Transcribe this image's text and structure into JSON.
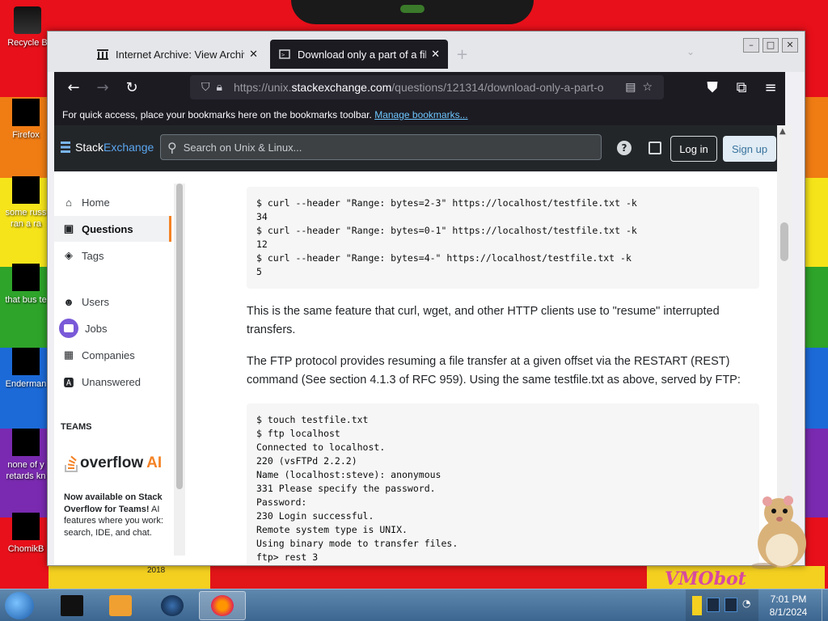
{
  "desktop": {
    "icons": [
      {
        "label": "Recycle B",
        "name": "recycle-bin"
      },
      {
        "label": "Firefox",
        "name": "firefox"
      },
      {
        "label": "some russ",
        "label2": "ran a ra",
        "name": "some-russ"
      },
      {
        "label": "that bus te",
        "name": "that-bus"
      },
      {
        "label": "Enderman",
        "name": "enderman"
      },
      {
        "label": "none of y",
        "label2": "retards kn",
        "name": "none-of-y"
      },
      {
        "label": "ChomikB",
        "name": "chomikb"
      }
    ],
    "wallpaper_text": "VMObot",
    "wallpaper_small_text": "2018"
  },
  "browser": {
    "tabs": [
      {
        "label": "Internet Archive: View Archive",
        "active": false
      },
      {
        "label": "Download only a part of a file",
        "active": true
      }
    ],
    "url": {
      "prefix": "https://unix.",
      "host": "stackexchange.com",
      "path": "/questions/121314/download-only-a-part-o"
    },
    "bookmarks_bar": {
      "text": "For quick access, place your bookmarks here on the bookmarks toolbar.",
      "link": "Manage bookmarks..."
    }
  },
  "site": {
    "logo_a": "Stack",
    "logo_b": "Exchange",
    "search_placeholder": "Search on Unix & Linux...",
    "login": "Log in",
    "signup": "Sign up",
    "nav": [
      {
        "label": "Home",
        "icon": "home-icon"
      },
      {
        "label": "Questions",
        "icon": "questions-icon",
        "active": true
      },
      {
        "label": "Tags",
        "icon": "tag-icon"
      },
      {
        "label": "Users",
        "icon": "users-icon"
      },
      {
        "label": "Jobs",
        "icon": "jobs-icon"
      },
      {
        "label": "Companies",
        "icon": "companies-icon"
      },
      {
        "label": "Unanswered",
        "icon": "unanswered-icon"
      }
    ],
    "teams": {
      "title": "TEAMS",
      "logo_text": "overflow",
      "logo_ai": "AI",
      "desc_bold": "Now available on Stack Overflow for Teams!",
      "desc_rest": " AI features where you work: search, IDE, and chat."
    }
  },
  "content": {
    "code1": [
      "$ curl --header \"Range: bytes=2-3\" https://localhost/testfile.txt -k",
      "34",
      "$ curl --header \"Range: bytes=0-1\" https://localhost/testfile.txt -k",
      "12",
      "$ curl --header \"Range: bytes=4-\" https://localhost/testfile.txt -k",
      "5"
    ],
    "para1": "This is the same feature that curl, wget, and other HTTP clients use to \"resume\" interrupted transfers.",
    "para2": "The FTP protocol provides resuming a file transfer at a given offset via the RESTART (REST) command (See section 4.1.3 of RFC 959). Using the same testfile.txt as above, served by FTP:",
    "code2": [
      "$ touch testfile.txt",
      "$ ftp localhost",
      "Connected to localhost.",
      "220 (vsFTPd 2.2.2)",
      "Name (localhost:steve): anonymous",
      "331 Please specify the password.",
      "Password:",
      "230 Login successful.",
      "Remote system type is UNIX.",
      "Using binary mode to transfer files.",
      "ftp> rest 3"
    ]
  },
  "taskbar": {
    "time": "7:01 PM",
    "date": "8/1/2024"
  }
}
